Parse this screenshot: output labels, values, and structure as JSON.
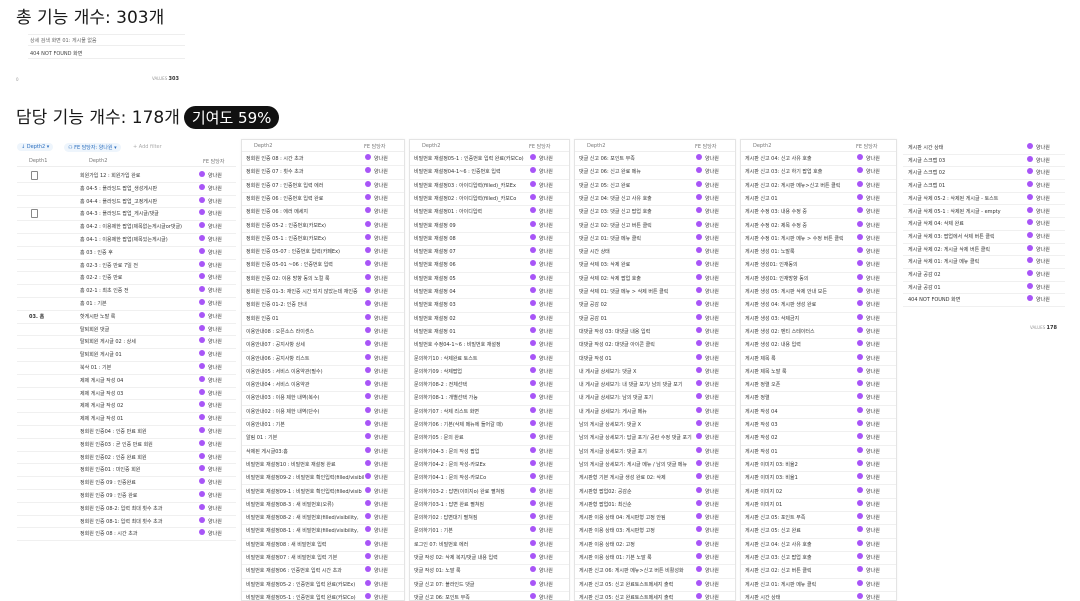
{
  "total_title": "총 기능 개수: 303개",
  "top_rows": [
    "상세 검색 화면 01: 게시물 없음",
    "404 NOT FOUND 화면"
  ],
  "top_count_label": "0",
  "top_values_label": "VALUES",
  "top_values_num": "303",
  "assigned_title": "담당 기능 개수: 178개",
  "contribution": "기여도 59%",
  "filters": {
    "depth": "Depth2",
    "fe": "FE 담당자: 양나원",
    "add": "+ Add filter"
  },
  "headers": {
    "depth1": "Depth1",
    "depth2": "Depth2",
    "fe": "FE 담당자"
  },
  "assignee": "양나원",
  "bottom_values_label": "VALUES",
  "bottom_values_num": "178",
  "p1": {
    "depth1": [
      "",
      "",
      "",
      "",
      "",
      "",
      "",
      "",
      "",
      "",
      "",
      "03. 홈",
      "",
      "",
      "",
      "",
      "",
      "",
      "",
      "",
      "",
      "",
      "",
      "",
      "",
      "",
      "",
      "",
      "",
      ""
    ],
    "rows": [
      "회원가입 12 : 회원가입 완료",
      "홈 04-5 : 플라잉드 팝업_생성게시판",
      "홈 04-4 : 플라잉드 팝업_고정게시판",
      "홈 04-3 : 플라잉드 팝업_게시글/댓글",
      "홈 04-2 : 이용제한 팝업(제목없는게시글or댓글)",
      "홈 04-1 : 이용제한 팝업(제목있는게시글)",
      "홈 03 : 인증 후",
      "홈 02-3 : 인증 만료 7일 전",
      "홈 02-2 : 인증 만료",
      "홈 02-1 : 최초 인증 전",
      "홈 01 : 기본",
      "핫게시판 노말 룩",
      "탈퇴회원 댓글",
      "탈퇴회원 게시글 02 : 상세",
      "탈퇴회원 게시글 01",
      "북삭 01 : 기본",
      "제제 게시글 작성 04",
      "제제 게시글 작성 03",
      "제제 게시글 작성 02",
      "제제 게시글 작성 01",
      "정회원 인증04 : 인증 만료 회원",
      "정회원 인증03 : 곧 인증 만료 회원",
      "정회원 인증02 : 인증 완료 회원",
      "정회원 인증01 : 미인증 회원",
      "정회원 인증 09 : 인증완료",
      "정회원 인증 09 : 인증 완료",
      "정회원 인증 08-2: 입력 최대 횟수 초과",
      "정회원 인증 08-1: 입력 최대 횟수 초과",
      "정회원 인증 08 : 시간 초과"
    ]
  },
  "p2": [
    "정회원 인증 08 : 시간 초과",
    "정회원 인증 07 : 횟수 초과",
    "정회원 인증 07 : 인증번호 입력 에러",
    "정회원 인증 06 : 인증번호 입력 완료",
    "정회원 인증 06 : 에러 메세지",
    "정회원 인증 05-2 : 인증번호(카보Ex)",
    "정회원 인증 05-1 : 인증번호(카보Ex)",
    "정회원 인증 05-07 : 인증번호 입력(카페Ex)",
    "정회원 인증 05-01 ~06 : 인증번호 입력",
    "정회원 인증 02: 이용 방향 동의 노컬 룩",
    "정회원 인증 01-3: 재인증 시간 되지 않았는데 재인증",
    "정회원 인증 01-2: 인증 안내",
    "정회원 인증 01",
    "이용안내08 : 오픈소스 라이센스",
    "이용안내07 : 공지사항 상세",
    "이용안내06 : 공지사항 리스트",
    "이용안내05 : 서비스 이용약관(필수)",
    "이용안내04 : 서비스 이용약관",
    "이용안내03 : 이용 제한 내역(복수)",
    "이용안내02 : 이용 제한 내역(단수)",
    "이용안내01 : 기본",
    "알림 01 : 기본",
    "삭제된 게시글03:홈",
    "비밀번호 재설정10 : 비밀번호 재설정 완료",
    "비밀번호 재설정09-2 : 비밀번호 확인입력(filled/visibility",
    "비밀번호 재설정09-1 : 비밀번호 확인입력(filled/visib",
    "비밀번호 재설정08-3 : 새 비밀번호(오류)",
    "비밀번호 재설정08-2 : 새 비밀번호(filled/visibility,",
    "비밀번호 재설정08-1 : 새 비밀번호(filled/visibility,",
    "비밀번호 재설정08 : 새 비밀번호 입력",
    "비밀번호 재설정07 : 새 비밀번호 입력 기본",
    "비밀번호 재설정06 : 인증번호 입력 시간 초과",
    "비밀번호 재설정05-2 : 인증번호 입력 완료(카보Ex)",
    "비밀번호 재설정05-1 : 인증번호 입력 완료(카보Co)"
  ],
  "p3": [
    "비밀번호 재설정05-1 : 인증번호 입력 완료(카보Co)",
    "비밀번호 재설정04-1~6 : 인증번호 입력",
    "비밀번호 재설정03 : 아이디입력(filled)_카보Ex",
    "비밀번호 재설정02 : 아이디입력(filled)_카보Co",
    "비밀번호 재설정01 : 아이디입력",
    "비밀번호 재설정 09",
    "비밀번호 재설정 08",
    "비밀번호 재설정 07",
    "비밀번호 재설정 06",
    "비밀번호 재설정 05",
    "비밀번호 재설정 04",
    "비밀번호 재설정 03",
    "비밀번호 재설정 02",
    "비밀번호 재설정 01",
    "비밀번호 수정04-1~6 : 비밀번호 재설정",
    "문의하기10 : 삭제완료 토스트",
    "문의하기09 : 삭제팝업",
    "문의하기08-2 : 전체선택",
    "문의하기08-1 : 개별선택 가능",
    "문의하기07 : 삭제 리스트 화면",
    "문의하기06 : 기본(삭제 메뉴에 들어갈 때)",
    "문의하기05 : 문의 완료",
    "문의하기04-3 : 문의 작성 팝업",
    "문의하기04-2 : 문의 작성-카보Ex",
    "문의하기04-1 : 문의 작성-카보Co",
    "문의하기03-2 : 답변(이미지o) 완료 펼쳐짐",
    "문의하기03-1 : 답변 완료 펼쳐짐",
    "문의하기02 : 답변대기 펼쳐짐",
    "문의하기01 : 기본",
    "로그인 07: 비밀번호 에러",
    "댓글 작성 02: 삭제 복지/댓글 내용 입력",
    "댓글 작성 01: 노말 룩",
    "댓글 신고 07: 블라인드 댓글",
    "댓글 신고 06: 포인트 부족"
  ],
  "p4": [
    "댓글 신고 06: 포인트 부족",
    "댓글 신고 06: 신고 완료 메뉴",
    "댓글 신고 05: 신고 완료",
    "댓글 신고 04: 댓글 신고 사유 호출",
    "댓글 신고 03: 댓글 신고 팝업 호출",
    "댓글 신고 02: 댓글 신고 버튼 클릭",
    "댓글 신고 01: 댓글 메뉴 클릭",
    "댓글 시간 상태",
    "댓글 삭제 03: 삭제 완료",
    "댓글 삭제 02: 삭제 팝업 호출",
    "댓글 삭제 01: 댓글 메뉴 > 삭제 버튼 클릭",
    "댓글 공감 02",
    "댓글 공감 01",
    "대댓글 작성 03: 대댓글 내용 입력",
    "대댓글 작성 02: 대댓글 아이콘 클릭",
    "대댓글 작성 01",
    "내 게시글 상세보기: 댓글 X",
    "내 게시글 상세보기: 내 댓글 포기/ 남의 댓글 포기",
    "내 게시글 상세보기: 남의 댓글 포기",
    "내 게시글 상세보기: 게시글 메뉴",
    "남의 게시글 상세보기: 댓글 X",
    "남의 게시글 상세보기: 답글 포기/ 공란 수정 댓글 포기",
    "남의 게시글 상세보기: 댓글 포기",
    "남의 게시글 상세보기: 게시글 메뉴 / 남의 댓글 메뉴",
    "게시판형 기본 게시글 생성 완료 02: 삭제",
    "게시판형 팝업02: 공감순",
    "게시판형 팝업01: 최신순",
    "게시판 이용 상태 04: 게시판형 고정 안됨",
    "게시판 이용 상태 03: 게시판형 고정",
    "게시판 이용 상태 02: 고정",
    "게시판 이용 상태 01: 기본 노말 룩",
    "게시판 신고 06: 게시판 메뉴>신고 버튼 비활성화",
    "게시판 신고 05: 신고 완료토스트메세지 출력",
    "게시판 신고 05: 신고 완료토스트메세지 출력"
  ],
  "p5": [
    "게시판 신고 04: 신고 사유 호출",
    "게시판 신고 03: 신고 하기 팝업 호출",
    "게시판 신고 02: 게시판 메뉴>신고 버튼 클릭",
    "게시판 신고 01",
    "게시판 수정 03: 내용 수정 중",
    "게시판 수정 02: 제목 수정 중",
    "게시판 수정 01: 게시판 메뉴 > 수정 버튼 클릭",
    "게시판 생성 01: 노말룩",
    "게시판 생성01: 인재동의",
    "게시판 생성01: 인재방향 동의",
    "게시판 생성 05: 게시판 삭제 안내 모든",
    "게시판 생성 04: 게시판 생성 완료",
    "게시판 생성 03: 삭제금지",
    "게시판 생성 02: 멘티 스테이터스",
    "게시판 생성 02: 내용 입력",
    "게시판 제목 록",
    "게시판 제목 노말 룩",
    "게시판 정렬 오픈",
    "게시판 정렬",
    "게시판 작성 04",
    "게시판 작성 03",
    "게시판 작성 02",
    "게시판 작성 01",
    "게시판 이미지 03: 비율2",
    "게시판 이미지 03: 비율1",
    "게시판 이미지 02",
    "게시판 이미지 01",
    "게시판 신고 05: 포인트 부족",
    "게시판 신고 05: 신고 완료",
    "게시판 신고 04: 신고 사유 호출",
    "게시판 신고 03: 신고 팝업 호출",
    "게시판 신고 02: 신고 버튼 클릭",
    "게시판 신고 01: 게시판 메뉴 클릭",
    "게시판 시간 상태"
  ],
  "p6": [
    "게시판 시간 상태",
    "게시글 스크랩 03",
    "게시글 스크랩 02",
    "게시글 스크랩 01",
    "게시글 삭제 05-2 : 삭제된 게시글 - 토스트",
    "게시글 삭제 05-1 : 삭제된 게시글 - empty",
    "게시글 삭제 04: 삭제 완료",
    "게시글 삭제 03: 팝업에서 삭제 버튼 클릭",
    "게시글 삭제 02: 게시글 삭제 버튼 클릭",
    "게시글 삭제 01: 게시글 메뉴 클릭",
    "게시글 공감 02",
    "게시글 공감 01",
    "404 NOT FOUND 화면"
  ]
}
